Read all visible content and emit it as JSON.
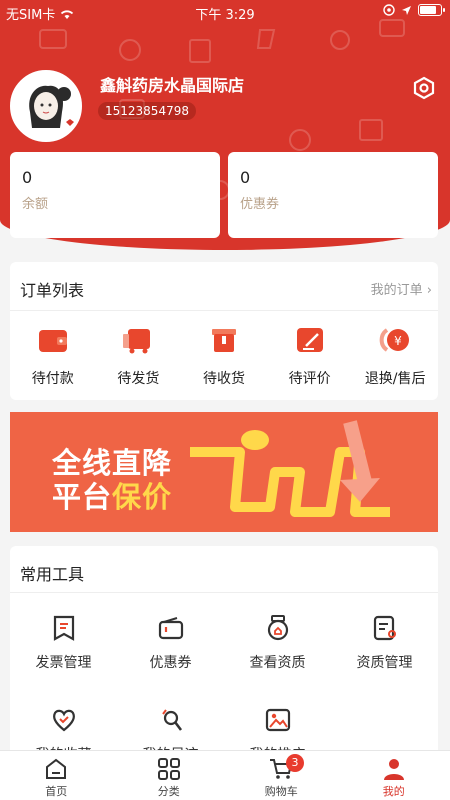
{
  "status_bar": {
    "carrier": "无SIM卡",
    "time": "下午 3:29",
    "battery_level": 0.85
  },
  "profile": {
    "store_name": "鑫斛药房水晶国际店",
    "phone": "15123854798",
    "settings_icon": "settings-hexagon-icon"
  },
  "balances": [
    {
      "value": "0",
      "label": "余额"
    },
    {
      "value": "0",
      "label": "优惠券"
    }
  ],
  "orders": {
    "title": "订单列表",
    "link": "我的订单 ›",
    "items": [
      {
        "label": "待付款",
        "icon": "wallet-icon"
      },
      {
        "label": "待发货",
        "icon": "truck-icon"
      },
      {
        "label": "待收货",
        "icon": "package-icon"
      },
      {
        "label": "待评价",
        "icon": "edit-review-icon"
      },
      {
        "label": "退换/售后",
        "icon": "refund-icon"
      }
    ]
  },
  "banner": {
    "line1": "全线直降",
    "line2_prefix": "平台",
    "line2_highlight": "保价"
  },
  "tools": {
    "title": "常用工具",
    "items": [
      {
        "label": "发票管理",
        "icon": "invoice-icon"
      },
      {
        "label": "优惠券",
        "icon": "coupon-icon"
      },
      {
        "label": "查看资质",
        "icon": "certificate-icon"
      },
      {
        "label": "资质管理",
        "icon": "document-manage-icon"
      },
      {
        "label": "我的收藏",
        "icon": "heart-icon"
      },
      {
        "label": "我的足迹",
        "icon": "footprint-icon"
      },
      {
        "label": "我的推广",
        "icon": "image-icon"
      }
    ]
  },
  "tabbar": {
    "items": [
      {
        "label": "首页",
        "icon": "home-icon"
      },
      {
        "label": "分类",
        "icon": "category-icon"
      },
      {
        "label": "购物车",
        "icon": "cart-icon",
        "badge": "3"
      },
      {
        "label": "我的",
        "icon": "user-icon"
      }
    ]
  },
  "colors": {
    "brand_red": "#d8352b",
    "banner_orange": "#ef6445",
    "highlight_yellow": "#ffd84a"
  }
}
